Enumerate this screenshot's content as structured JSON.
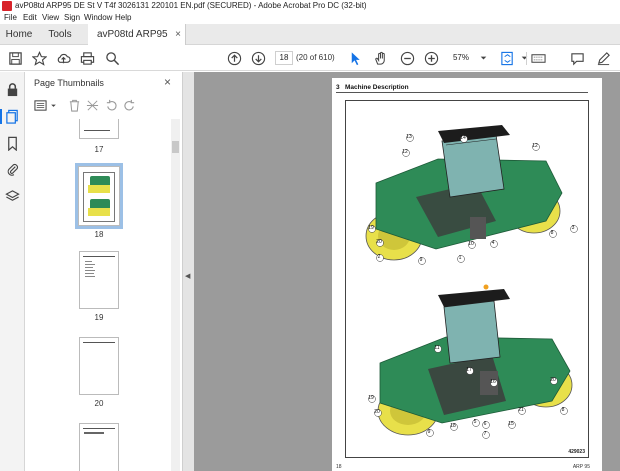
{
  "window": {
    "title": "avP08td ARP95 DE St V T4f 3026131 220101 EN.pdf (SECURED) - Adobe Acrobat Pro DC (32-bit)"
  },
  "menu": {
    "items": [
      "File",
      "Edit",
      "View",
      "Sign",
      "Window",
      "Help"
    ]
  },
  "tabs": {
    "home": "Home",
    "tools": "Tools",
    "document": "avP08td ARP95 DE...",
    "close": "×"
  },
  "toolbar": {
    "page_value": "18",
    "page_count": "(20 of 610)",
    "zoom": "57%"
  },
  "thumbnails": {
    "title": "Page Thumbnails",
    "close": "×",
    "pages": [
      {
        "label": "17"
      },
      {
        "label": "18",
        "selected": true
      },
      {
        "label": "19"
      },
      {
        "label": "20"
      }
    ]
  },
  "document": {
    "section_number": "3",
    "section_title": "Machine Description",
    "callouts_top": [
      "13",
      "14",
      "12",
      "12",
      "19",
      "20",
      "2",
      "9",
      "1",
      "10",
      "4",
      "8",
      "3"
    ],
    "callouts_bottom": [
      "11",
      "17",
      "16",
      "19",
      "20",
      "9",
      "18",
      "5",
      "6",
      "7",
      "15",
      "21",
      "20",
      "8"
    ],
    "figure_id": "429023",
    "footer_page": "18",
    "footer_ref": "ARP 95"
  },
  "colors": {
    "accent": "#1473e6",
    "machine_yellow": "#e8e04a",
    "machine_green": "#2e8b57",
    "cab_black": "#1c1c1c"
  }
}
